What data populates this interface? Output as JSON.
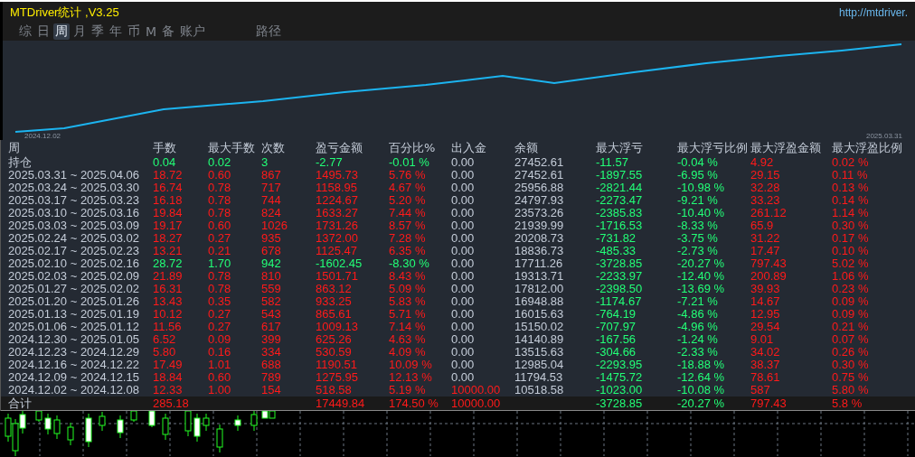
{
  "window": {
    "title": "MTDriver统计 ,V3.25",
    "url": "http://mtdriver."
  },
  "tabs": [
    {
      "label": "综",
      "selected": false
    },
    {
      "label": "日",
      "selected": false
    },
    {
      "label": "周",
      "selected": true
    },
    {
      "label": "月",
      "selected": false
    },
    {
      "label": "季",
      "selected": false
    },
    {
      "label": "年",
      "selected": false
    },
    {
      "label": "币",
      "selected": false
    },
    {
      "label": "M",
      "selected": false
    },
    {
      "label": "备",
      "selected": false
    },
    {
      "label": "账户",
      "selected": false
    },
    {
      "label": "路径",
      "selected": false
    }
  ],
  "balance_chart": {
    "start_label": "2024.12.02",
    "end_label": "2025.03.31"
  },
  "table": {
    "columns": [
      "周",
      "手数",
      "最大手数",
      "次数",
      "盈亏金额",
      "百分比%",
      "出入金",
      "余额",
      "最大浮亏",
      "最大浮亏比例",
      "最大浮盈金额",
      "最大浮盈比例"
    ],
    "rows": [
      {
        "kind": "loss",
        "deposit": false,
        "cells": [
          "持仓",
          "0.04",
          "0.02",
          "3",
          "-2.77",
          "-0.01 %",
          "0.00",
          "27452.61",
          "-11.57",
          "-0.04 %",
          "4.92",
          "0.02 %"
        ]
      },
      {
        "kind": "gain",
        "deposit": false,
        "cells": [
          "2025.03.31 ~ 2025.04.06",
          "18.72",
          "0.60",
          "867",
          "1495.73",
          "5.76 %",
          "0.00",
          "27452.61",
          "-1897.55",
          "-6.95 %",
          "29.15",
          "0.11 %"
        ]
      },
      {
        "kind": "gain",
        "deposit": false,
        "cells": [
          "2025.03.24 ~ 2025.03.30",
          "16.74",
          "0.78",
          "717",
          "1158.95",
          "4.67 %",
          "0.00",
          "25956.88",
          "-2821.44",
          "-10.98 %",
          "32.28",
          "0.13 %"
        ]
      },
      {
        "kind": "gain",
        "deposit": false,
        "cells": [
          "2025.03.17 ~ 2025.03.23",
          "16.18",
          "0.78",
          "744",
          "1224.67",
          "5.20 %",
          "0.00",
          "24797.93",
          "-2273.47",
          "-9.21 %",
          "33.23",
          "0.14 %"
        ]
      },
      {
        "kind": "gain",
        "deposit": false,
        "cells": [
          "2025.03.10 ~ 2025.03.16",
          "19.84",
          "0.78",
          "824",
          "1633.27",
          "7.44 %",
          "0.00",
          "23573.26",
          "-2385.83",
          "-10.40 %",
          "261.12",
          "1.14 %"
        ]
      },
      {
        "kind": "gain",
        "deposit": false,
        "cells": [
          "2025.03.03 ~ 2025.03.09",
          "19.17",
          "0.60",
          "1026",
          "1731.26",
          "8.57 %",
          "0.00",
          "21939.99",
          "-1716.53",
          "-8.33 %",
          "65.9",
          "0.30 %"
        ]
      },
      {
        "kind": "gain",
        "deposit": false,
        "cells": [
          "2025.02.24 ~ 2025.03.02",
          "18.27",
          "0.27",
          "935",
          "1372.00",
          "7.28 %",
          "0.00",
          "20208.73",
          "-731.82",
          "-3.75 %",
          "31.22",
          "0.17 %"
        ]
      },
      {
        "kind": "gain",
        "deposit": false,
        "cells": [
          "2025.02.17 ~ 2025.02.23",
          "13.21",
          "0.21",
          "678",
          "1125.47",
          "6.35 %",
          "0.00",
          "18836.73",
          "-485.33",
          "-2.73 %",
          "17.47",
          "0.10 %"
        ]
      },
      {
        "kind": "loss",
        "deposit": false,
        "cells": [
          "2025.02.10 ~ 2025.02.16",
          "28.72",
          "1.70",
          "942",
          "-1602.45",
          "-8.30 %",
          "0.00",
          "17711.26",
          "-3728.85",
          "-20.27 %",
          "797.43",
          "5.02 %"
        ]
      },
      {
        "kind": "gain",
        "deposit": false,
        "cells": [
          "2025.02.03 ~ 2025.02.09",
          "21.89",
          "0.78",
          "810",
          "1501.71",
          "8.43 %",
          "0.00",
          "19313.71",
          "-2233.97",
          "-12.40 %",
          "200.89",
          "1.06 %"
        ]
      },
      {
        "kind": "gain",
        "deposit": false,
        "cells": [
          "2025.01.27 ~ 2025.02.02",
          "16.31",
          "0.78",
          "559",
          "863.12",
          "5.09 %",
          "0.00",
          "17812.00",
          "-2398.50",
          "-13.69 %",
          "39.93",
          "0.23 %"
        ]
      },
      {
        "kind": "gain",
        "deposit": false,
        "cells": [
          "2025.01.20 ~ 2025.01.26",
          "13.43",
          "0.35",
          "582",
          "933.25",
          "5.83 %",
          "0.00",
          "16948.88",
          "-1174.67",
          "-7.21 %",
          "14.67",
          "0.09 %"
        ]
      },
      {
        "kind": "gain",
        "deposit": false,
        "cells": [
          "2025.01.13 ~ 2025.01.19",
          "10.12",
          "0.27",
          "543",
          "865.61",
          "5.71 %",
          "0.00",
          "16015.63",
          "-764.19",
          "-4.86 %",
          "12.95",
          "0.09 %"
        ]
      },
      {
        "kind": "gain",
        "deposit": false,
        "cells": [
          "2025.01.06 ~ 2025.01.12",
          "11.56",
          "0.27",
          "617",
          "1009.13",
          "7.14 %",
          "0.00",
          "15150.02",
          "-707.97",
          "-4.96 %",
          "29.54",
          "0.21 %"
        ]
      },
      {
        "kind": "gain",
        "deposit": false,
        "cells": [
          "2024.12.30 ~ 2025.01.05",
          "6.52",
          "0.09",
          "399",
          "625.26",
          "4.63 %",
          "0.00",
          "14140.89",
          "-167.56",
          "-1.24 %",
          "9.01",
          "0.07 %"
        ]
      },
      {
        "kind": "gain",
        "deposit": false,
        "cells": [
          "2024.12.23 ~ 2024.12.29",
          "5.80",
          "0.16",
          "334",
          "530.59",
          "4.09 %",
          "0.00",
          "13515.63",
          "-304.66",
          "-2.33 %",
          "34.02",
          "0.26 %"
        ]
      },
      {
        "kind": "gain",
        "deposit": false,
        "cells": [
          "2024.12.16 ~ 2024.12.22",
          "17.49",
          "1.01",
          "688",
          "1190.51",
          "10.09 %",
          "0.00",
          "12985.04",
          "-2293.95",
          "-18.88 %",
          "38.37",
          "0.30 %"
        ]
      },
      {
        "kind": "gain",
        "deposit": false,
        "cells": [
          "2024.12.09 ~ 2024.12.15",
          "18.84",
          "0.60",
          "789",
          "1275.95",
          "12.13 %",
          "0.00",
          "11794.53",
          "-1475.72",
          "-12.64 %",
          "78.61",
          "0.75 %"
        ]
      },
      {
        "kind": "gain",
        "deposit": true,
        "cells": [
          "2024.12.02 ~ 2024.12.08",
          "12.33",
          "1.00",
          "154",
          "518.58",
          "5.19 %",
          "10000.00",
          "10518.58",
          "-1023.00",
          "-10.08 %",
          "587",
          "5.80 %"
        ]
      }
    ],
    "total": {
      "kind": "gain",
      "deposit": true,
      "cells": [
        "合计",
        "285.18",
        "",
        "",
        "17449.84",
        "174.50 %",
        "10000.00",
        "",
        "-3728.85",
        "-20.27 %",
        "797.43",
        "5.8 %"
      ]
    }
  }
}
